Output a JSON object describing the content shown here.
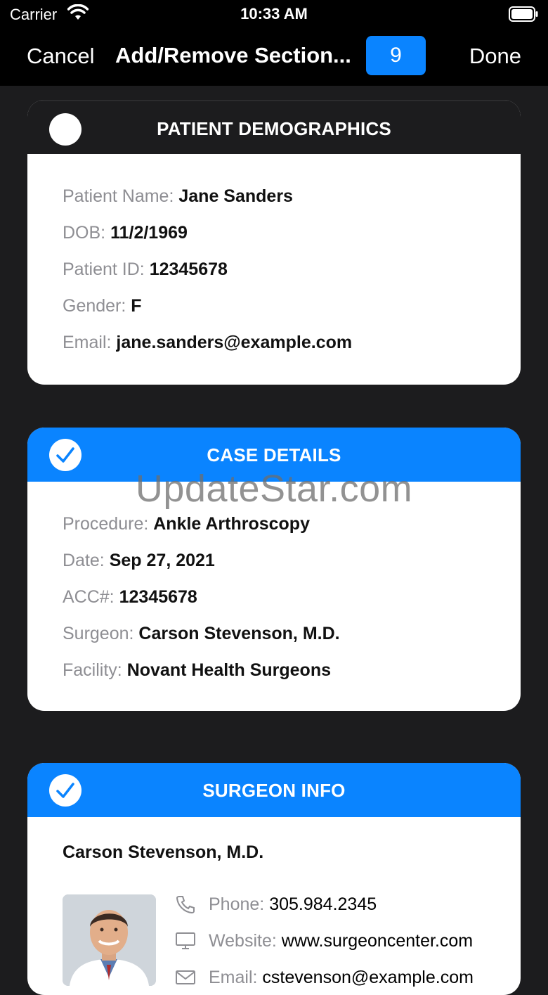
{
  "status_bar": {
    "carrier": "Carrier",
    "time": "10:33 AM"
  },
  "nav": {
    "cancel_label": "Cancel",
    "title": "Add/Remove Section...",
    "selected_count": "9",
    "done_label": "Done"
  },
  "sections": {
    "demographics": {
      "title": "PATIENT DEMOGRAPHICS",
      "selected": false,
      "rows": [
        {
          "label": "Patient Name:",
          "value": "Jane Sanders"
        },
        {
          "label": "DOB:",
          "value": "11/2/1969"
        },
        {
          "label": "Patient ID:",
          "value": "12345678"
        },
        {
          "label": "Gender:",
          "value": "F"
        },
        {
          "label": "Email:",
          "value": "jane.sanders@example.com"
        }
      ]
    },
    "case": {
      "title": "CASE DETAILS",
      "selected": true,
      "rows": [
        {
          "label": "Procedure:",
          "value": "Ankle Arthroscopy"
        },
        {
          "label": "Date:",
          "value": "Sep 27, 2021"
        },
        {
          "label": "ACC#:",
          "value": "12345678"
        },
        {
          "label": "Surgeon:",
          "value": "Carson Stevenson, M.D."
        },
        {
          "label": "Facility:",
          "value": "Novant Health Surgeons"
        }
      ]
    },
    "surgeon": {
      "title": "SURGEON INFO",
      "selected": true,
      "name": "Carson Stevenson, M.D.",
      "phone_label": "Phone:",
      "phone": "305.984.2345",
      "website_label": "Website:",
      "website": "www.surgeoncenter.com",
      "email_label": "Email:",
      "email": "cstevenson@example.com"
    }
  },
  "watermark": "UpdateStar.com",
  "colors": {
    "accent": "#0a84ff",
    "background": "#1c1c1e",
    "nav_bg": "#000000"
  },
  "icons": [
    "wifi-icon",
    "battery-icon",
    "checkmark-icon",
    "phone-icon",
    "monitor-icon",
    "mail-icon"
  ]
}
